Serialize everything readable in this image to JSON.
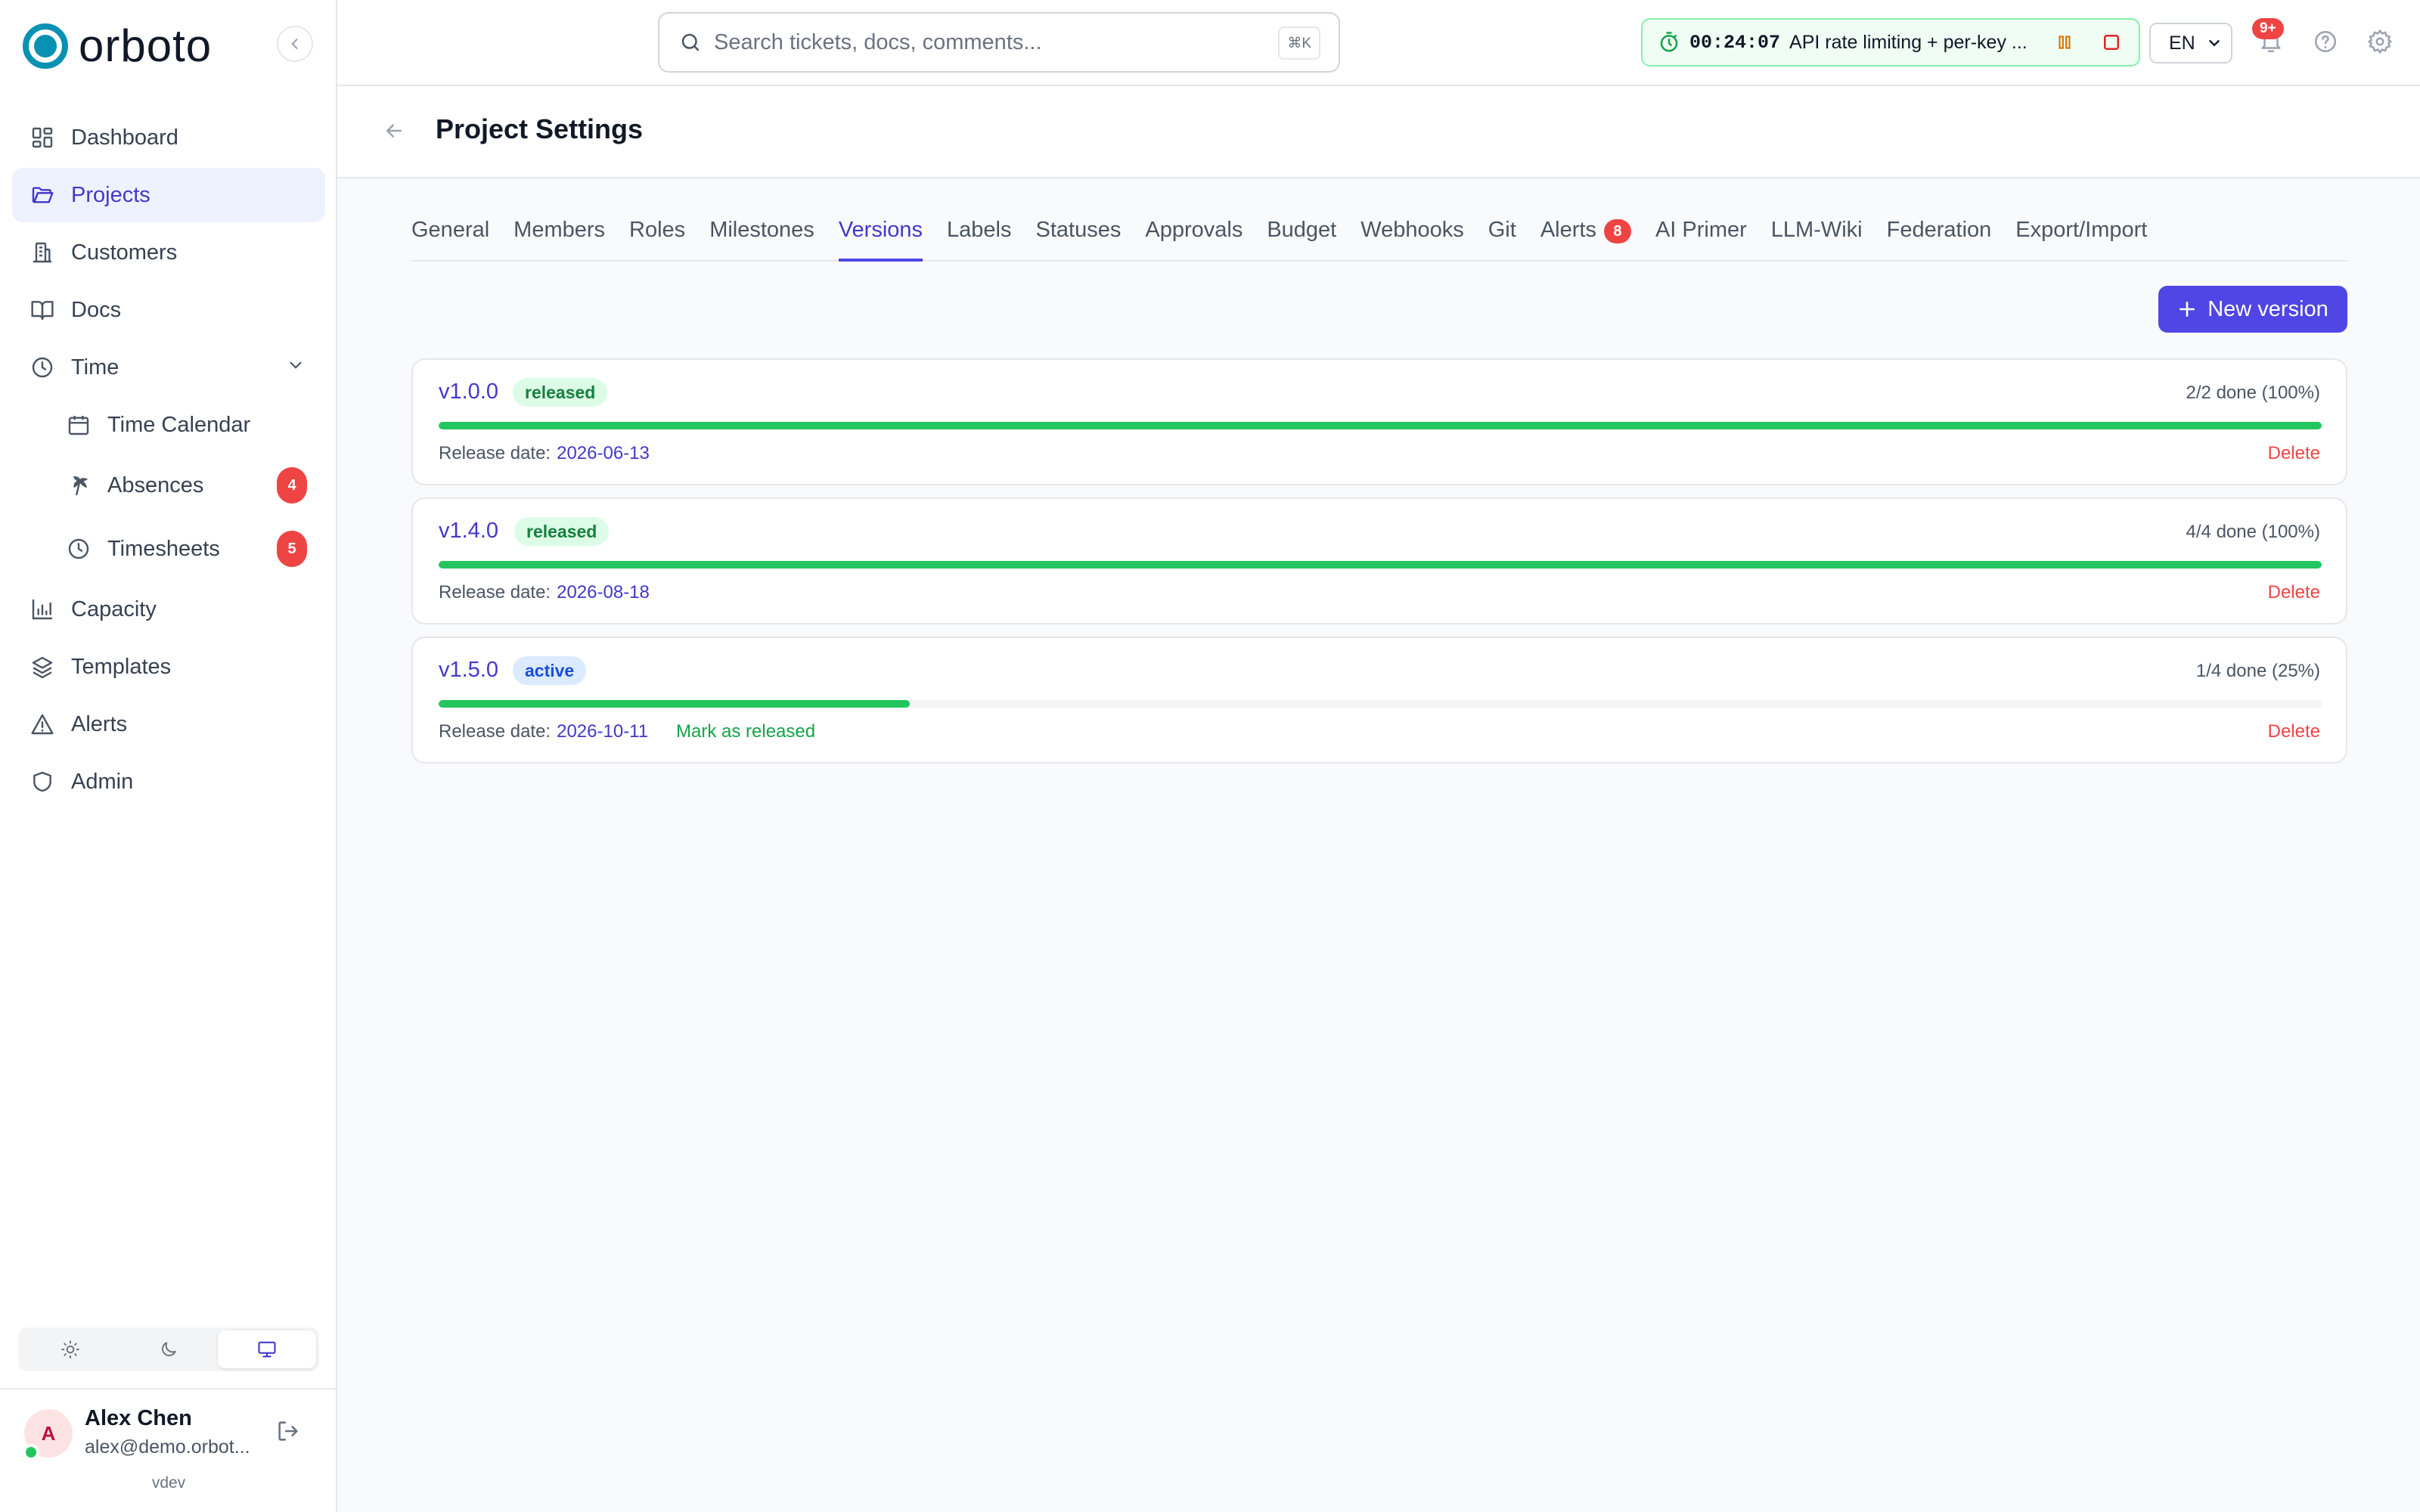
{
  "app": {
    "name": "orboto",
    "version_label": "vdev"
  },
  "sidebar": {
    "items": [
      {
        "label": "Dashboard",
        "icon": "dashboard-icon"
      },
      {
        "label": "Projects",
        "icon": "folder-icon",
        "active": true
      },
      {
        "label": "Customers",
        "icon": "building-icon"
      },
      {
        "label": "Docs",
        "icon": "book-icon"
      },
      {
        "label": "Time",
        "icon": "clock-icon",
        "expanded": true
      },
      {
        "label": "Time Calendar",
        "icon": "calendar-icon"
      },
      {
        "label": "Absences",
        "icon": "palm-tree-icon",
        "badge": "4"
      },
      {
        "label": "Timesheets",
        "icon": "clock-icon",
        "badge": "5"
      },
      {
        "label": "Capacity",
        "icon": "bar-chart-icon"
      },
      {
        "label": "Templates",
        "icon": "layers-icon"
      },
      {
        "label": "Alerts",
        "icon": "warning-icon"
      },
      {
        "label": "Admin",
        "icon": "shield-icon"
      }
    ],
    "theme_selected": "system"
  },
  "user": {
    "initial": "A",
    "name": "Alex Chen",
    "email": "alex@demo.orbot..."
  },
  "topbar": {
    "search_placeholder": "Search tickets, docs, comments...",
    "search_shortcut": "⌘K",
    "timer": {
      "time": "00:24:07",
      "task": "API rate limiting + per-key ..."
    },
    "language": "EN",
    "notifications_badge": "9+"
  },
  "page": {
    "title": "Project Settings"
  },
  "tabs": [
    {
      "label": "General"
    },
    {
      "label": "Members"
    },
    {
      "label": "Roles"
    },
    {
      "label": "Milestones"
    },
    {
      "label": "Versions",
      "active": true
    },
    {
      "label": "Labels"
    },
    {
      "label": "Statuses"
    },
    {
      "label": "Approvals"
    },
    {
      "label": "Budget"
    },
    {
      "label": "Webhooks"
    },
    {
      "label": "Git"
    },
    {
      "label": "Alerts",
      "badge": "8"
    },
    {
      "label": "AI Primer"
    },
    {
      "label": "LLM-Wiki"
    },
    {
      "label": "Federation"
    },
    {
      "label": "Export/Import"
    }
  ],
  "actions": {
    "new_version": "New version"
  },
  "versions": [
    {
      "name": "v1.0.0",
      "status": "released",
      "done": "2/2 done (100%)",
      "progress": 1.0,
      "release_label": "Release date:",
      "release_date": "2026-06-13",
      "delete": "Delete"
    },
    {
      "name": "v1.4.0",
      "status": "released",
      "done": "4/4 done (100%)",
      "progress": 1.0,
      "release_label": "Release date:",
      "release_date": "2026-08-18",
      "delete": "Delete"
    },
    {
      "name": "v1.5.0",
      "status": "active",
      "done": "1/4 done (25%)",
      "progress": 0.25,
      "release_label": "Release date:",
      "release_date": "2026-10-11",
      "mark_released": "Mark as released",
      "delete": "Delete"
    }
  ],
  "colors": {
    "accent": "#4f46e5",
    "progress": "#22c55e",
    "danger": "#ef4444",
    "brand": "#0891b2"
  }
}
